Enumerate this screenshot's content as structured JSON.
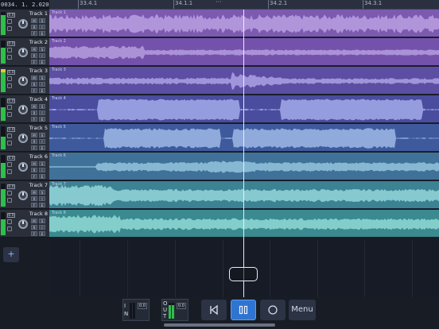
{
  "timecode": "0034. 1. 2.020",
  "ruler": {
    "ticks": [
      "33.4.1",
      "34.1.1",
      "34.2.1",
      "34.3.1"
    ],
    "handle": "···"
  },
  "tracks": [
    {
      "name": "Track 1",
      "volume": "0.0",
      "color": "#7c5ab0",
      "wave": "#b79be0",
      "level": 0.85,
      "peak": false
    },
    {
      "name": "Track 2",
      "volume": "0.0",
      "color": "#7452ac",
      "wave": "#b199dc",
      "level": 0.7,
      "peak": false
    },
    {
      "name": "Track 3",
      "volume": "0.0",
      "color": "#5c4ea3",
      "wave": "#a79ce0",
      "level": 0.95,
      "peak": true
    },
    {
      "name": "Track 4",
      "volume": "0.0",
      "color": "#4a4c9e",
      "wave": "#9ea6e6",
      "level": 0.6,
      "peak": false
    },
    {
      "name": "Track 5",
      "volume": "0.0",
      "color": "#3e5a9c",
      "wave": "#98b2e2",
      "level": 0.55,
      "peak": false
    },
    {
      "name": "Track 6",
      "volume": "0.0",
      "color": "#3f7199",
      "wave": "#8fc0d8",
      "level": 0.65,
      "peak": false
    },
    {
      "name": "Track 7",
      "volume": "0.0",
      "color": "#3b8293",
      "wave": "#8fd0d6",
      "level": 0.75,
      "peak": false
    },
    {
      "name": "Track 8",
      "volume": "0.0",
      "color": "#3a8a90",
      "wave": "#8cd4d2",
      "level": 0.7,
      "peak": false
    }
  ],
  "add_track_label": "+",
  "input": {
    "label": "IN",
    "value": "0.0"
  },
  "output": {
    "label": "OUT",
    "value": "0.0"
  },
  "transport": {
    "rewind_icon": "skip-to-start-icon",
    "play_icon": "pause-icon",
    "record_icon": "record-circle-icon",
    "menu_label": "Menu"
  },
  "colors": {
    "accent": "#2f74d0",
    "meter": "#2fbf4a",
    "playhead": "#e9edf2"
  }
}
